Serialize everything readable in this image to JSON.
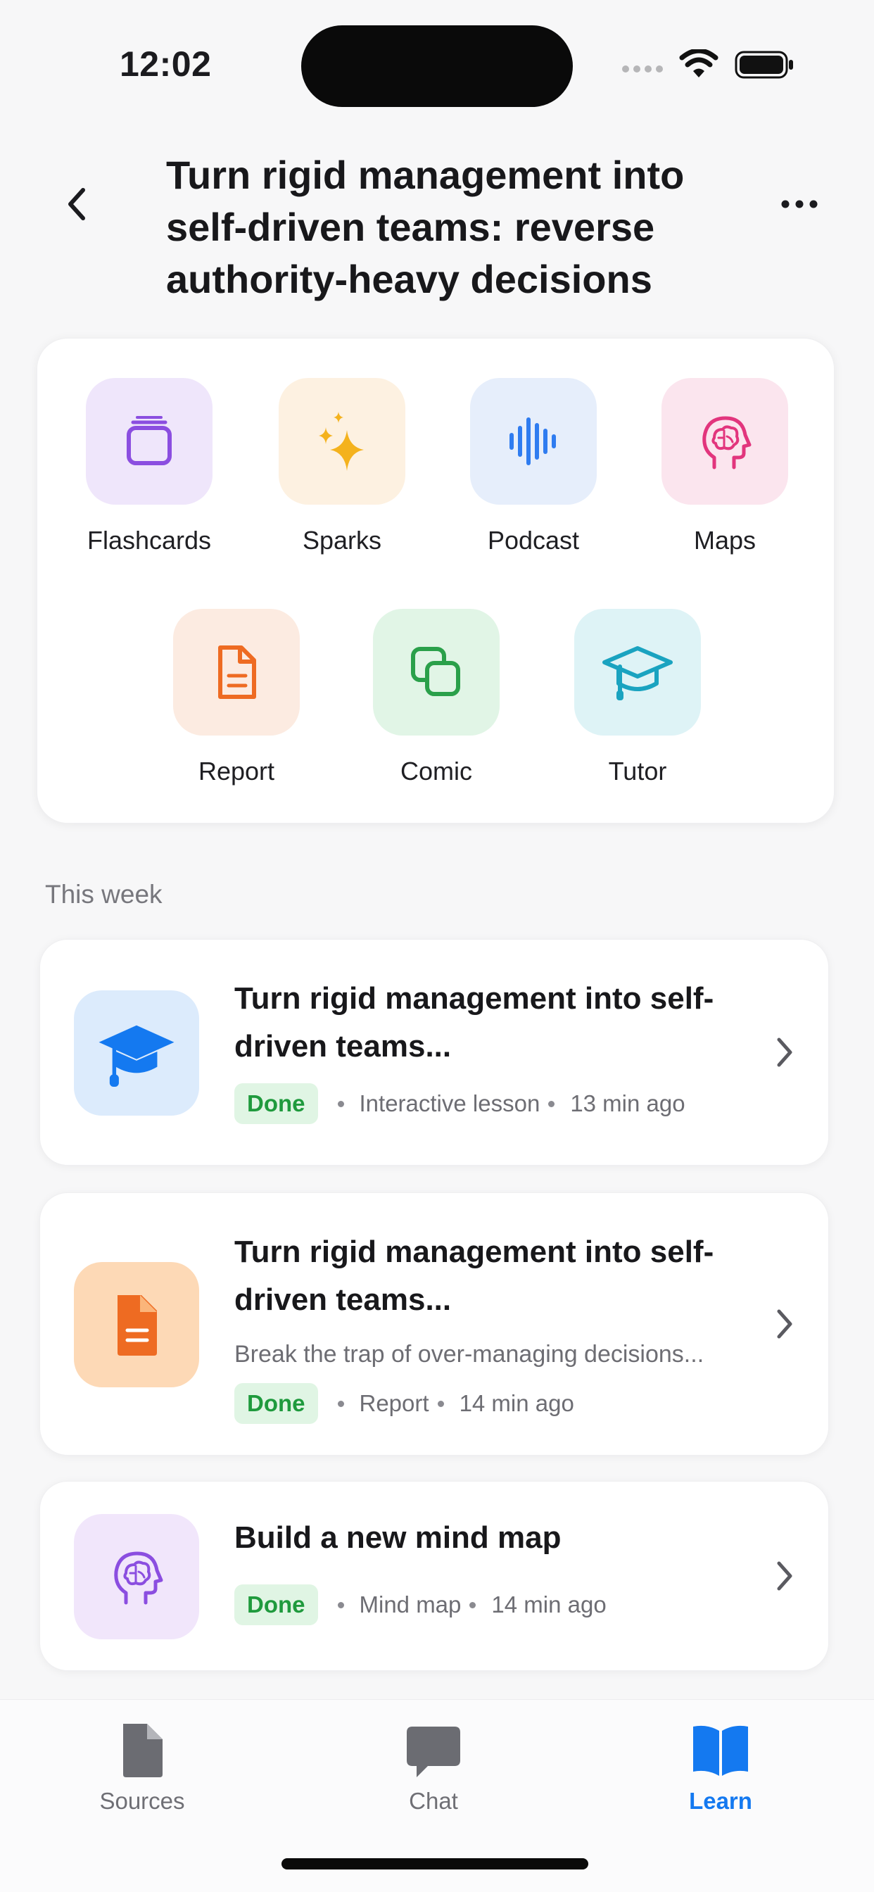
{
  "status_bar": {
    "time": "12:02"
  },
  "header": {
    "title": "Turn rigid management into self-driven teams: reverse authority-heavy decisions",
    "back_icon": "chevron-left-icon",
    "more_icon": "ellipsis-icon"
  },
  "tools": [
    {
      "label": "Flashcards",
      "icon": "cards-stack-icon",
      "bg": "#efe6fb",
      "color": "#8b4ee0"
    },
    {
      "label": "Sparks",
      "icon": "sparkles-icon",
      "bg": "#fdf1e1",
      "color": "#f4b21d"
    },
    {
      "label": "Podcast",
      "icon": "waveform-icon",
      "bg": "#e6eefb",
      "color": "#2f7cf0"
    },
    {
      "label": "Maps",
      "icon": "brain-head-icon",
      "bg": "#fbe5ee",
      "color": "#e2357d"
    },
    {
      "label": "Report",
      "icon": "document-icon",
      "bg": "#fcebe1",
      "color": "#ee6b22"
    },
    {
      "label": "Comic",
      "icon": "overlapping-squares-icon",
      "bg": "#e1f5e6",
      "color": "#2aa04a"
    },
    {
      "label": "Tutor",
      "icon": "graduation-cap-icon",
      "bg": "#def3f6",
      "color": "#1aa3c0"
    }
  ],
  "section_label": "This week",
  "activities": [
    {
      "title": "Turn rigid management into self-driven teams...",
      "subtitle": "",
      "status": "Done",
      "type": "Interactive lesson",
      "time": "13 min ago",
      "icon": "graduation-cap-icon",
      "bg": "#dcebfc",
      "color": "#1479f0"
    },
    {
      "title": "Turn rigid management into self-driven teams...",
      "subtitle": "Break the trap of over-managing decisions...",
      "status": "Done",
      "type": "Report",
      "time": "14 min ago",
      "icon": "document-icon",
      "bg": "#fdd9b6",
      "color": "#ee6b22"
    },
    {
      "title": "Build a new mind map",
      "subtitle": "",
      "status": "Done",
      "type": "Mind map",
      "time": "14 min ago",
      "icon": "brain-head-icon",
      "bg": "#f1e6fb",
      "color": "#8b4ee0"
    }
  ],
  "bottom_nav": [
    {
      "label": "Sources",
      "icon": "file-icon",
      "active": false
    },
    {
      "label": "Chat",
      "icon": "chat-bubble-icon",
      "active": false
    },
    {
      "label": "Learn",
      "icon": "open-book-icon",
      "active": true
    }
  ],
  "colors": {
    "accent": "#1479f0",
    "done_badge_bg": "#e0f5e4",
    "done_badge_text": "#1f9a3d"
  }
}
